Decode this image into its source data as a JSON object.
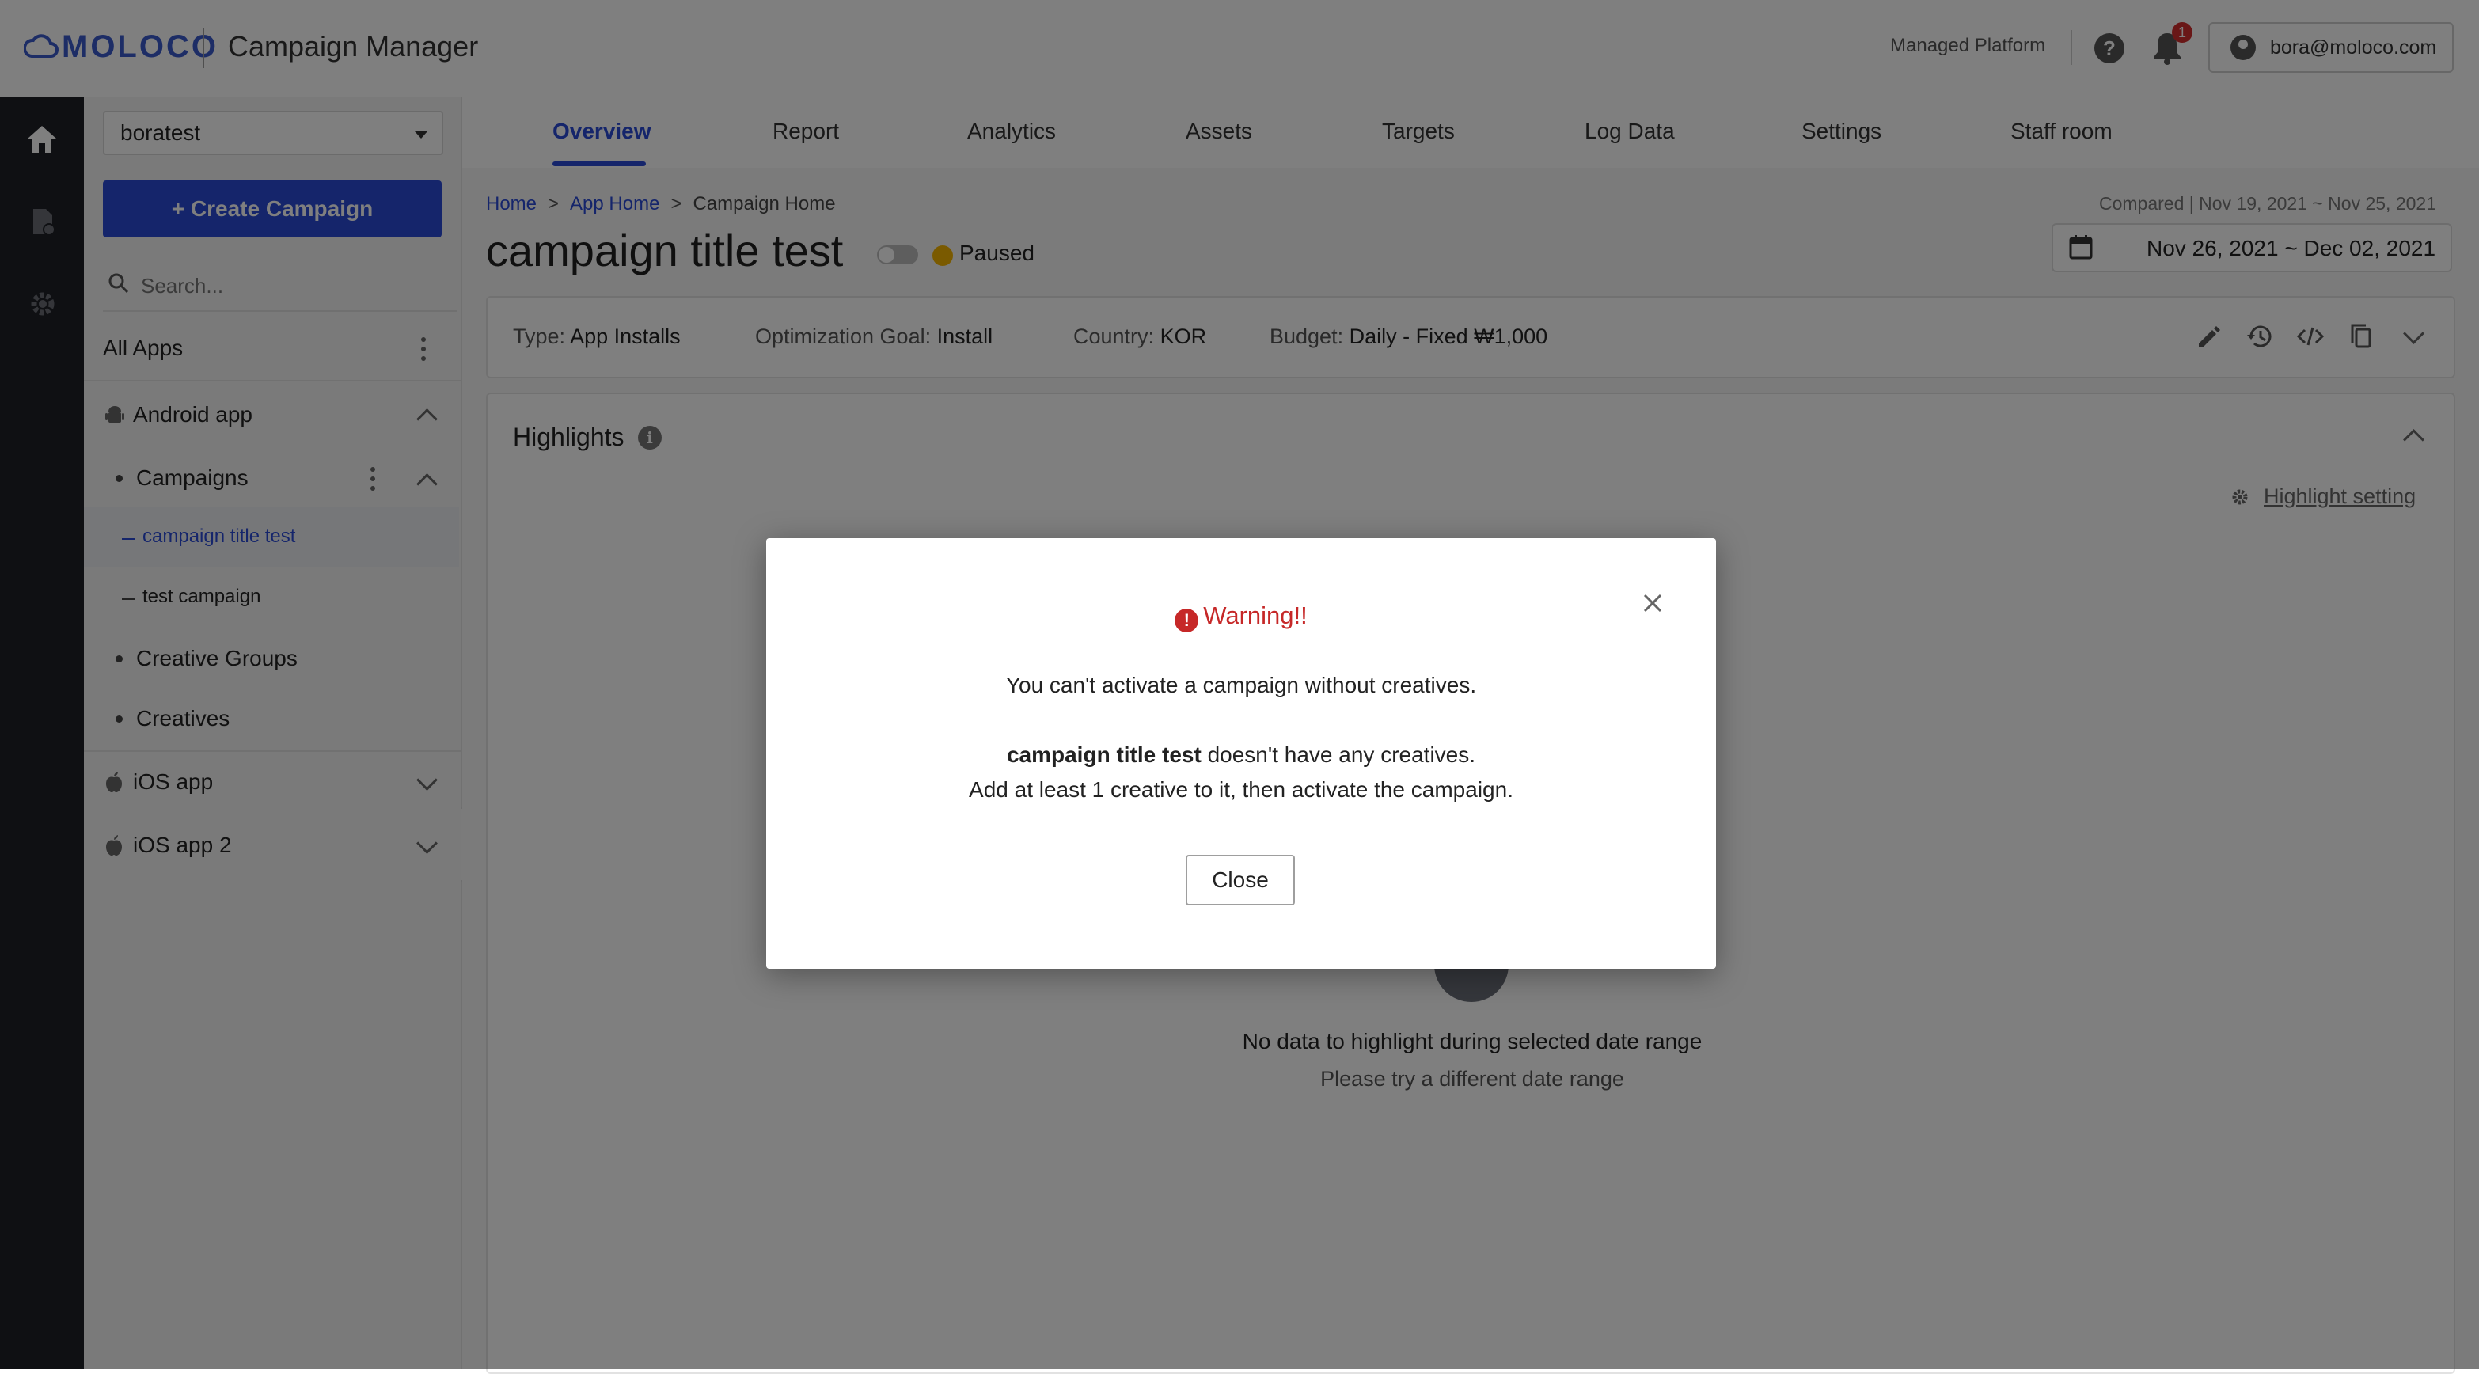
{
  "header": {
    "logo_text": "MOLOCO",
    "app_title": "Campaign Manager",
    "managed_platform": "Managed Platform",
    "notification_count": "1",
    "user_email": "bora@moloco.com"
  },
  "sidebar": {
    "account": "boratest",
    "create_button": "Create Campaign",
    "search_placeholder": "Search...",
    "all_apps": "All Apps",
    "android_app": "Android app",
    "campaigns": "Campaigns",
    "campaign_items": [
      "campaign title test",
      "test campaign"
    ],
    "creative_groups": "Creative Groups",
    "creatives": "Creatives",
    "ios_app": "iOS app",
    "ios_app_2": "iOS app 2"
  },
  "tabs": [
    "Overview",
    "Report",
    "Analytics",
    "Assets",
    "Targets",
    "Log Data",
    "Settings",
    "Staff room"
  ],
  "main": {
    "breadcrumb": [
      "Home",
      "App Home",
      "Campaign Home"
    ],
    "title": "campaign title test",
    "status": "Paused",
    "compared": "Compared | Nov 19, 2021 ~ Nov 25, 2021",
    "date_range": "Nov 26, 2021 ~ Dec 02, 2021",
    "info": {
      "type_label": "Type:",
      "type_value": "App Installs",
      "goal_label": "Optimization Goal:",
      "goal_value": "Install",
      "country_label": "Country:",
      "country_value": "KOR",
      "budget_label": "Budget:",
      "budget_value": "Daily - Fixed ₩1,000"
    },
    "highlights": {
      "title": "Highlights",
      "setting": "Highlight setting",
      "empty_main": "No data to highlight during selected date range",
      "empty_sub": "Please try a different date range"
    }
  },
  "modal": {
    "title": "Warning!!",
    "line1": "You can't activate a campaign without creatives.",
    "campaign_name": "campaign title test",
    "line2_rest": " doesn't have any creatives.",
    "line3": "Add at least 1 creative to it, then activate the campaign.",
    "close": "Close"
  },
  "colors": {
    "accent": "#2a4bd7",
    "warning": "#c62828",
    "paused": "#f5b400",
    "rail": "#1f2127"
  }
}
